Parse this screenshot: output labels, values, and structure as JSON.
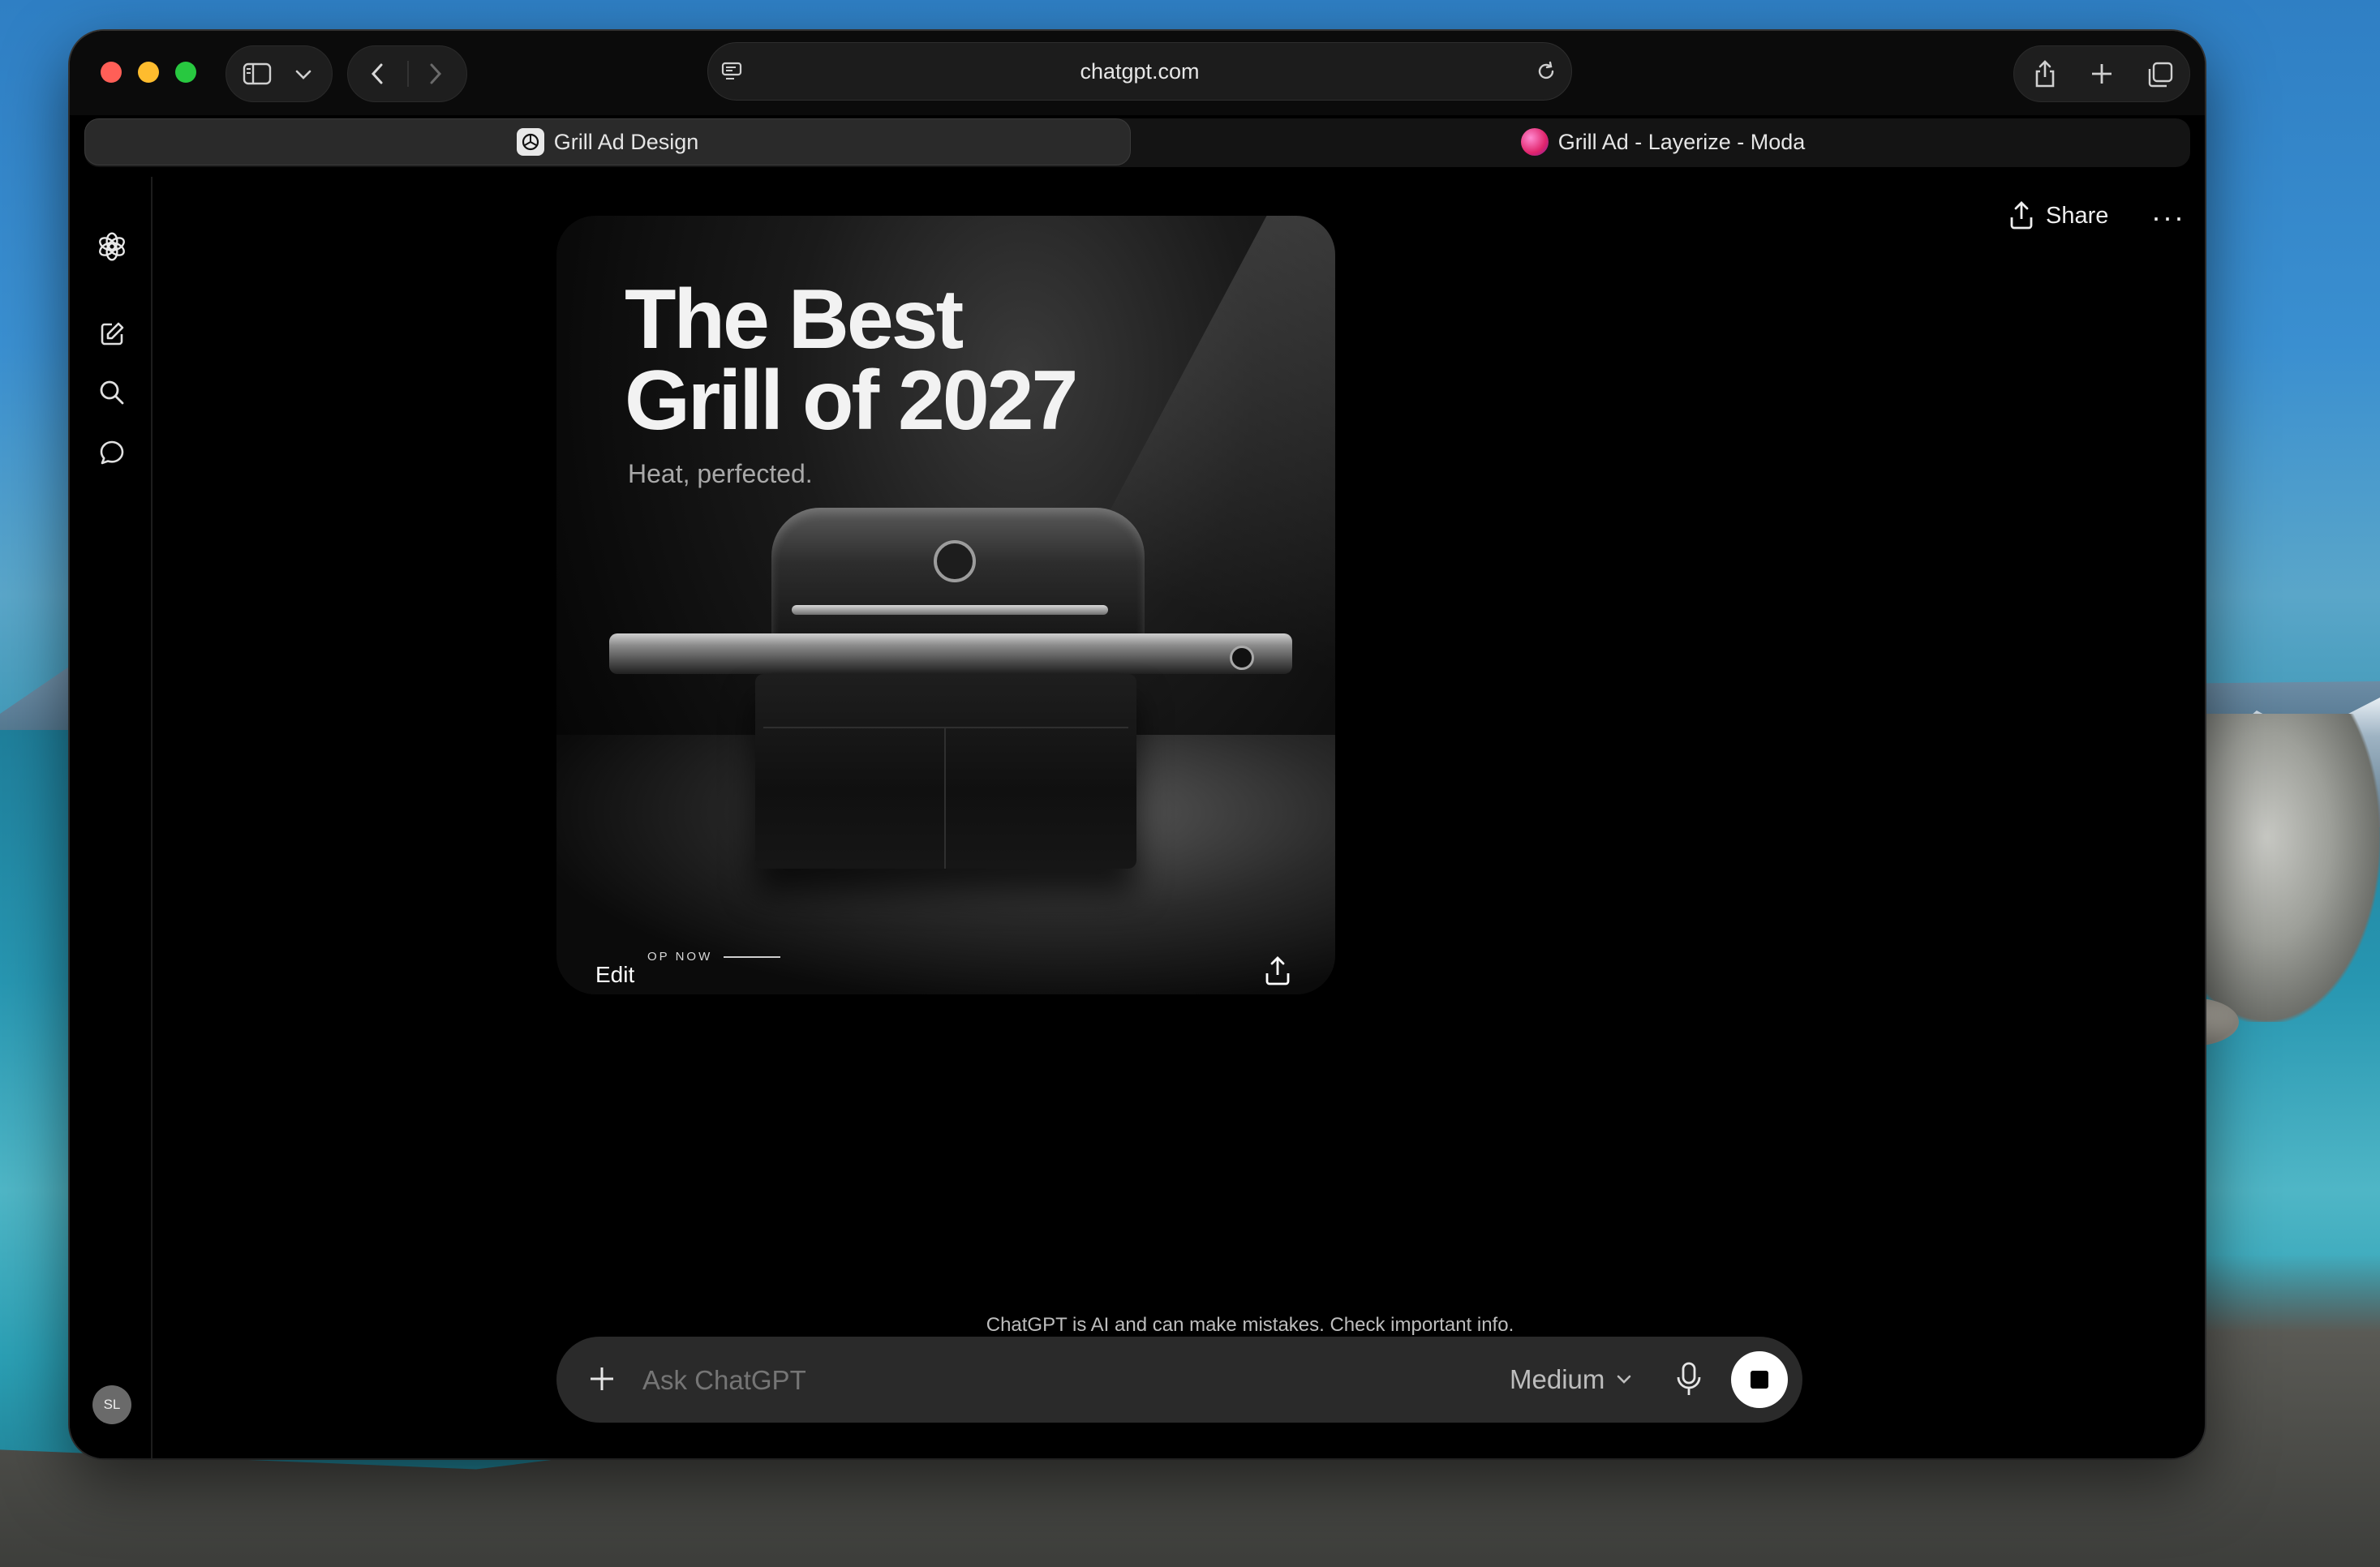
{
  "browser": {
    "url": "chatgpt.com",
    "tabs": [
      {
        "label": "Grill Ad Design",
        "active": true,
        "icon": "chatgpt-logo-icon"
      },
      {
        "label": "Grill Ad - Layerize - Moda",
        "active": false,
        "icon": "moda-logo-icon"
      }
    ]
  },
  "header": {
    "share_label": "Share",
    "more_label": "···"
  },
  "ad": {
    "title": "The Best\nGrill of 2027",
    "subtitle": "Heat, perfected.",
    "cta": "OP NOW",
    "edit_label": "Edit"
  },
  "sidebar": {
    "avatar_initials": "SL"
  },
  "composer": {
    "disclaimer": "ChatGPT is AI and can make mistakes. Check important info.",
    "placeholder": "Ask ChatGPT",
    "model": "Medium"
  },
  "colors": {
    "window_bg": "#000000",
    "composer_bg": "#2a2a2a",
    "accent": "#ffffff"
  }
}
